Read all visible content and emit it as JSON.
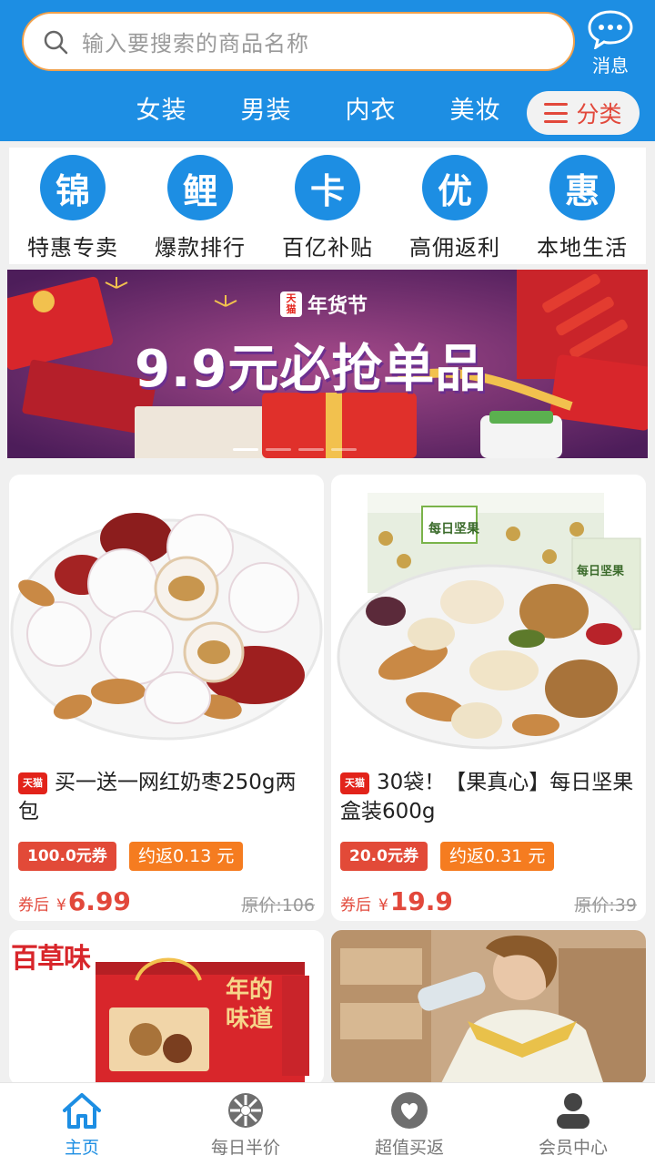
{
  "header": {
    "search_placeholder": "输入要搜索的商品名称",
    "message_label": "消息",
    "tabs": [
      "女装",
      "男装",
      "内衣",
      "美妆"
    ],
    "category_label": "分类"
  },
  "quick_icons": [
    {
      "glyph": "锦",
      "label": "特惠专卖"
    },
    {
      "glyph": "鲤",
      "label": "爆款排行"
    },
    {
      "glyph": "卡",
      "label": "百亿补贴"
    },
    {
      "glyph": "优",
      "label": "高佣返利"
    },
    {
      "glyph": "惠",
      "label": "本地生活"
    }
  ],
  "banner": {
    "tmall": "天猫",
    "festival": "年货节",
    "title": "9.9元必抢单品"
  },
  "products": [
    {
      "badge": "天猫",
      "title": "买一送一网红奶枣250g两包",
      "coupon": "100.0元券",
      "rebate": "约返0.13 元",
      "after_label": "券后",
      "currency": "¥",
      "price": "6.99",
      "original": "原价:106"
    },
    {
      "badge": "天猫",
      "title": "30袋！【果真心】每日坚果盒装600g",
      "coupon": "20.0元券",
      "rebate": "约返0.31 元",
      "after_label": "券后",
      "currency": "¥",
      "price": "19.9",
      "original": "原价:39"
    }
  ],
  "partial_products": [
    {
      "brand": "百草味",
      "box_text": "年的味道"
    },
    {
      "brand": ""
    }
  ],
  "bottom_nav": [
    {
      "icon": "home-icon",
      "label": "主页",
      "active": true
    },
    {
      "icon": "wheel-icon",
      "label": "每日半价",
      "active": false
    },
    {
      "icon": "heart-icon",
      "label": "超值买返",
      "active": false
    },
    {
      "icon": "user-icon",
      "label": "会员中心",
      "active": false
    }
  ],
  "colors": {
    "primary": "#1d8ee3",
    "accent_red": "#e2483b",
    "rebate_orange": "#f57c20",
    "search_border": "#f0a04b"
  }
}
